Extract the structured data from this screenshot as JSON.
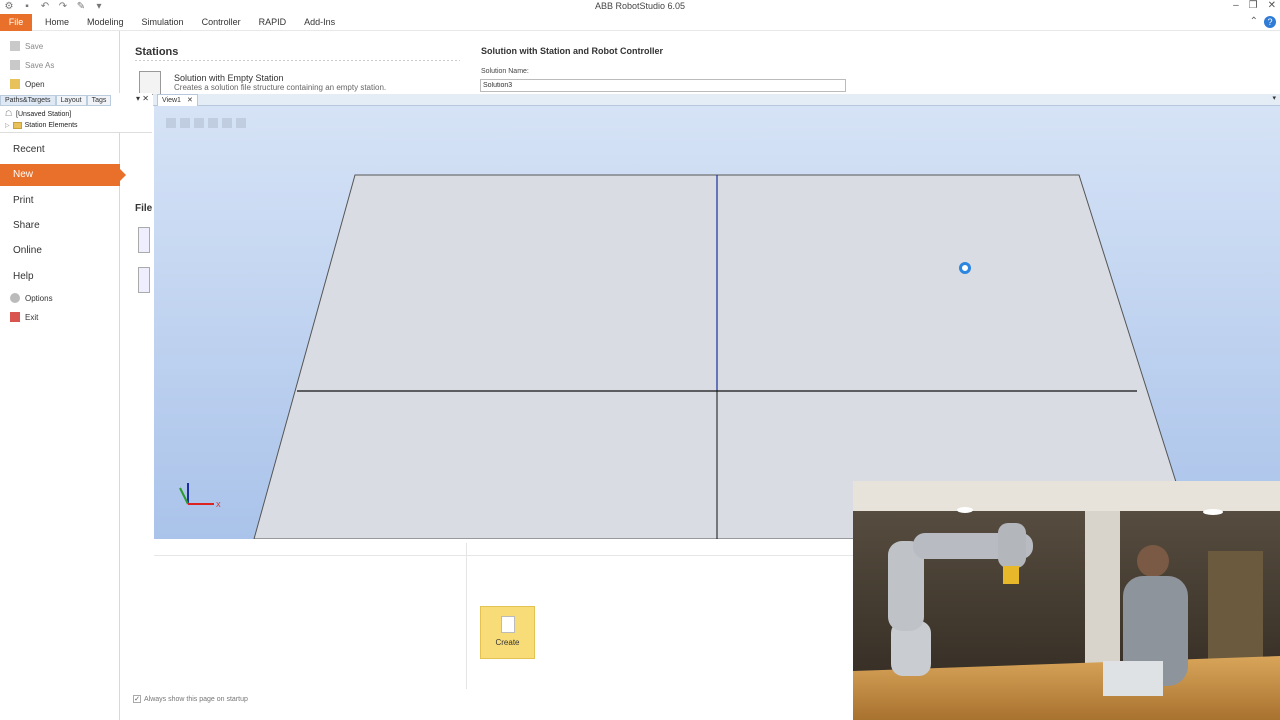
{
  "app": {
    "title": "ABB RobotStudio 6.05"
  },
  "ribbon": {
    "file_label": "File",
    "tabs": [
      "Home",
      "Modeling",
      "Simulation",
      "Controller",
      "RAPID",
      "Add-Ins"
    ]
  },
  "backstage": {
    "save": "Save",
    "save_as": "Save As",
    "open": "Open",
    "recent": "Recent",
    "new": "New",
    "print": "Print",
    "share": "Share",
    "online": "Online",
    "help": "Help",
    "options": "Options",
    "exit": "Exit"
  },
  "new_page": {
    "stations_heading": "Stations",
    "empty_station_title": "Solution with Empty Station",
    "empty_station_desc": "Creates a solution file structure containing an empty station.",
    "right_heading": "Solution with Station and Robot Controller",
    "solution_name_label": "Solution Name:",
    "solution_name_value": "Solution3",
    "files_heading_partial": "File",
    "create_label": "Create",
    "startup_label": "Always show this page on startup"
  },
  "explorer": {
    "tabs": [
      "Paths&Targets",
      "Layout",
      "Tags"
    ],
    "tree_root": "[Unsaved Station]",
    "tree_child": "Station Elements"
  },
  "view": {
    "tab_label": "View1",
    "axis_x_label": "X"
  },
  "colors": {
    "accent": "#e8702a",
    "viewport_top": "#d6e3f6",
    "viewport_bottom": "#aac3ea",
    "floor": "#d9dde3",
    "create_button": "#f8dc78"
  },
  "icons": {
    "save": "save-icon",
    "open": "folder-open-icon",
    "options": "gear-icon",
    "exit": "exit-icon",
    "help": "help-icon"
  }
}
